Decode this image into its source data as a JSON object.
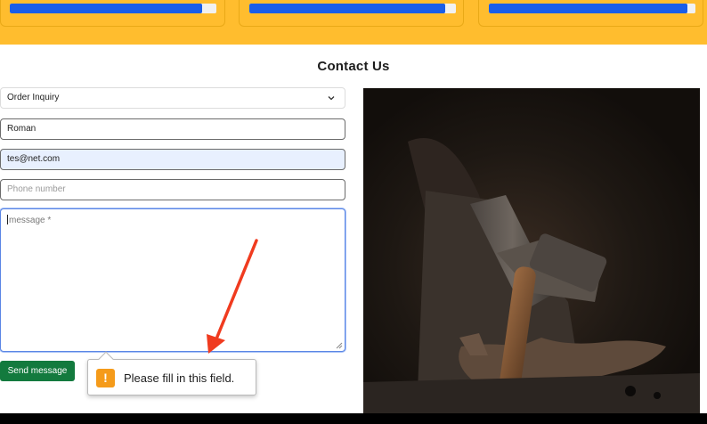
{
  "skills": [
    {
      "percent": 93
    },
    {
      "percent": 95
    },
    {
      "percent": 96
    }
  ],
  "contact": {
    "title": "Contact Us",
    "subject_selected": "Order Inquiry",
    "name_value": "Roman",
    "email_value": "tes@net.com",
    "phone_placeholder": "Phone number",
    "message_placeholder": "message *",
    "send_label": "Send message"
  },
  "validation": {
    "message": "Please fill in this field.",
    "icon": "warning-icon"
  },
  "colors": {
    "band": "#ffbd2e",
    "progress": "#1a5ee8",
    "button": "#137a3e",
    "annotation_arrow": "#f03b1f"
  }
}
